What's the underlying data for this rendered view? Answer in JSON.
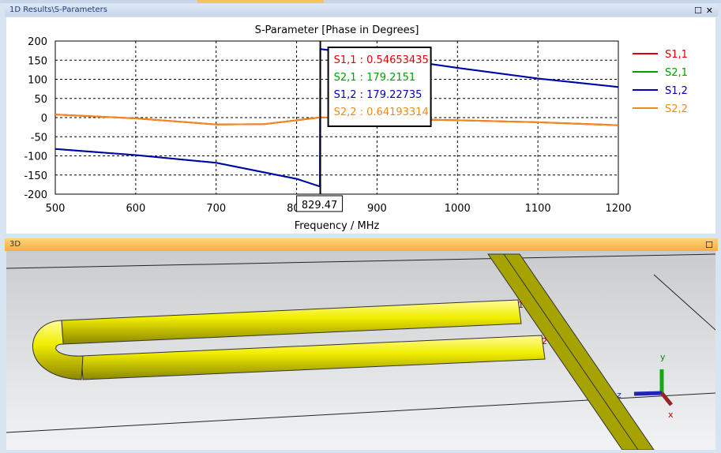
{
  "panels": {
    "plot_title": "1D Results\\S-Parameters",
    "view_title": "3D"
  },
  "chart_data": {
    "type": "line",
    "title": "S-Parameter [Phase in Degrees]",
    "xlabel": "Frequency / MHz",
    "ylabel": "",
    "xlim": [
      500,
      1200
    ],
    "ylim": [
      -200,
      200
    ],
    "xticks": [
      500,
      600,
      700,
      800,
      900,
      1000,
      1100,
      1200
    ],
    "yticks": [
      200,
      150,
      100,
      50,
      0,
      -50,
      -100,
      -150,
      -200
    ],
    "grid": true,
    "legend": "right",
    "series": [
      {
        "name": "S1,1",
        "color": "#e00000",
        "x": [
          500,
          600,
          700,
          760,
          829.47,
          900,
          1000,
          1100,
          1200
        ],
        "y": [
          8,
          -2,
          -18,
          -17,
          0.55,
          -3,
          -7,
          -12,
          -20
        ]
      },
      {
        "name": "S2,1",
        "color": "#00a000",
        "x": [
          500,
          600,
          700,
          800,
          829,
          829.47,
          900,
          1000,
          1100,
          1200
        ],
        "y": [
          -82,
          -98,
          -118,
          -160,
          -180,
          179.2,
          160,
          130,
          102,
          80
        ]
      },
      {
        "name": "S1,2",
        "color": "#0000b0",
        "x": [
          500,
          600,
          700,
          800,
          829,
          829.47,
          900,
          1000,
          1100,
          1200
        ],
        "y": [
          -82,
          -98,
          -118,
          -160,
          -180,
          179.2,
          160,
          130,
          102,
          80
        ]
      },
      {
        "name": "S2,2",
        "color": "#f08a1c",
        "x": [
          500,
          600,
          700,
          760,
          829.47,
          900,
          1000,
          1100,
          1200
        ],
        "y": [
          8,
          -2,
          -18,
          -17,
          0.64,
          -3,
          -7,
          -12,
          -20
        ]
      }
    ],
    "marker": {
      "x_label": "829.47",
      "readout": [
        {
          "text": "S1,1 : 0.54653435",
          "color": "#e00000"
        },
        {
          "text": "S2,1 : 179.2151",
          "color": "#00a000"
        },
        {
          "text": "S1,2 : 179.22735",
          "color": "#0000b0"
        },
        {
          "text": "S2,2 : 0.64193314",
          "color": "#f08a1c"
        }
      ]
    }
  },
  "axes_widget": {
    "x": "x",
    "y": "y",
    "z": "z"
  },
  "ports": [
    "1",
    "2"
  ]
}
